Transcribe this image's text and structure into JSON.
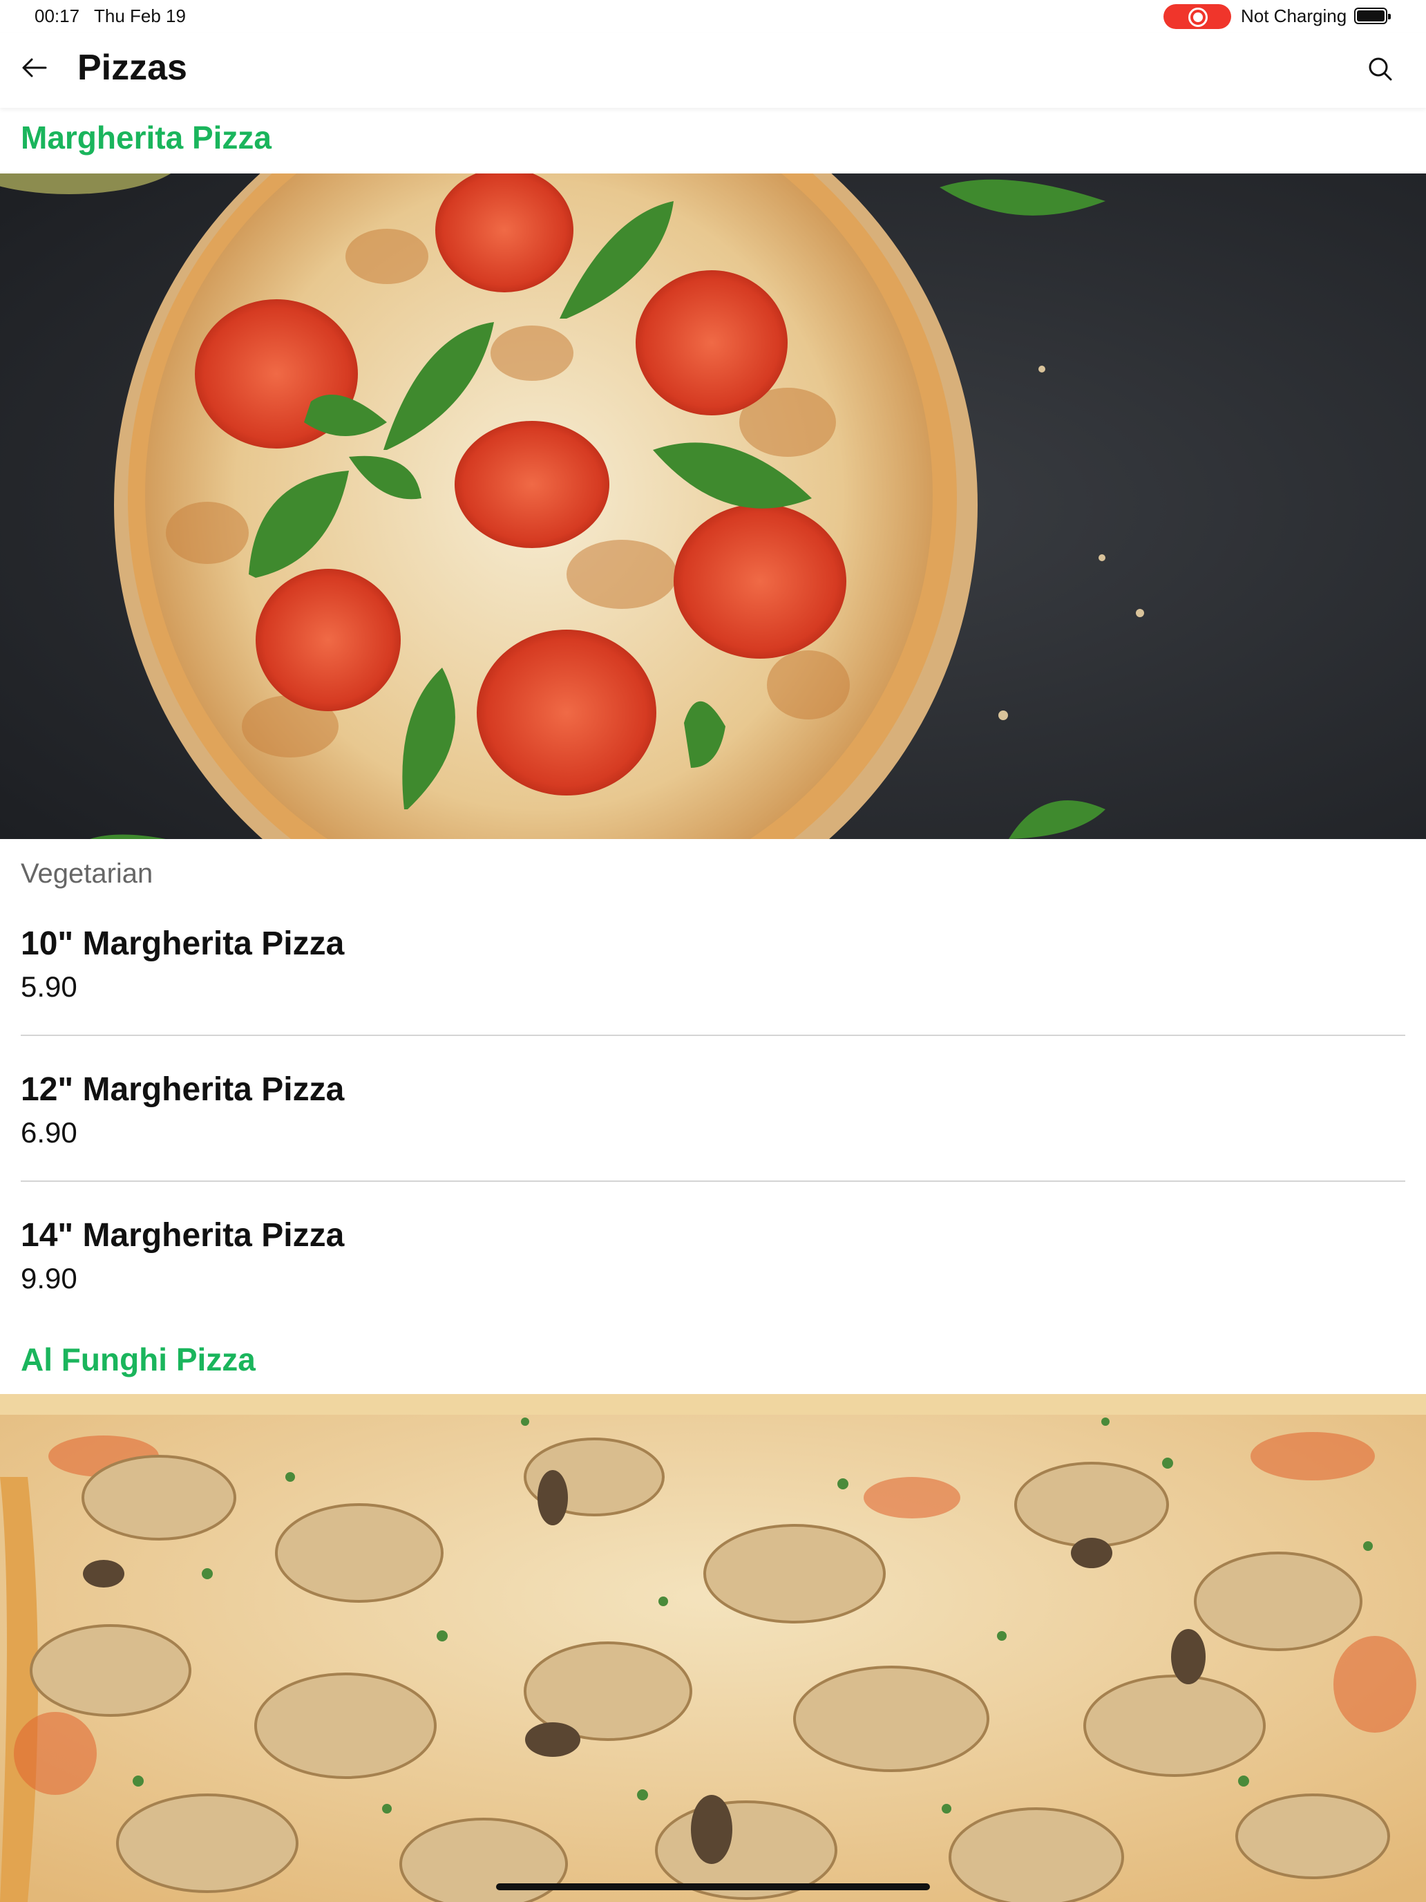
{
  "status_bar": {
    "time": "00:17",
    "date": "Thu Feb 19",
    "battery_status": "Not Charging",
    "recording_color": "#f0352b"
  },
  "app_bar": {
    "title": "Pizzas",
    "back_icon": "arrow-left-icon",
    "search_icon": "search-icon"
  },
  "colors": {
    "accent": "#1ab55c",
    "text": "#111111",
    "muted": "#666666",
    "divider": "#d4d4d4"
  },
  "sections": [
    {
      "title": "Margherita Pizza",
      "category": "Vegetarian",
      "items": [
        {
          "name": "10\" Margherita Pizza",
          "price": "5.90"
        },
        {
          "name": "12\" Margherita Pizza",
          "price": "6.90"
        },
        {
          "name": "14\" Margherita Pizza",
          "price": "9.90"
        }
      ]
    },
    {
      "title": "Al Funghi Pizza"
    }
  ]
}
